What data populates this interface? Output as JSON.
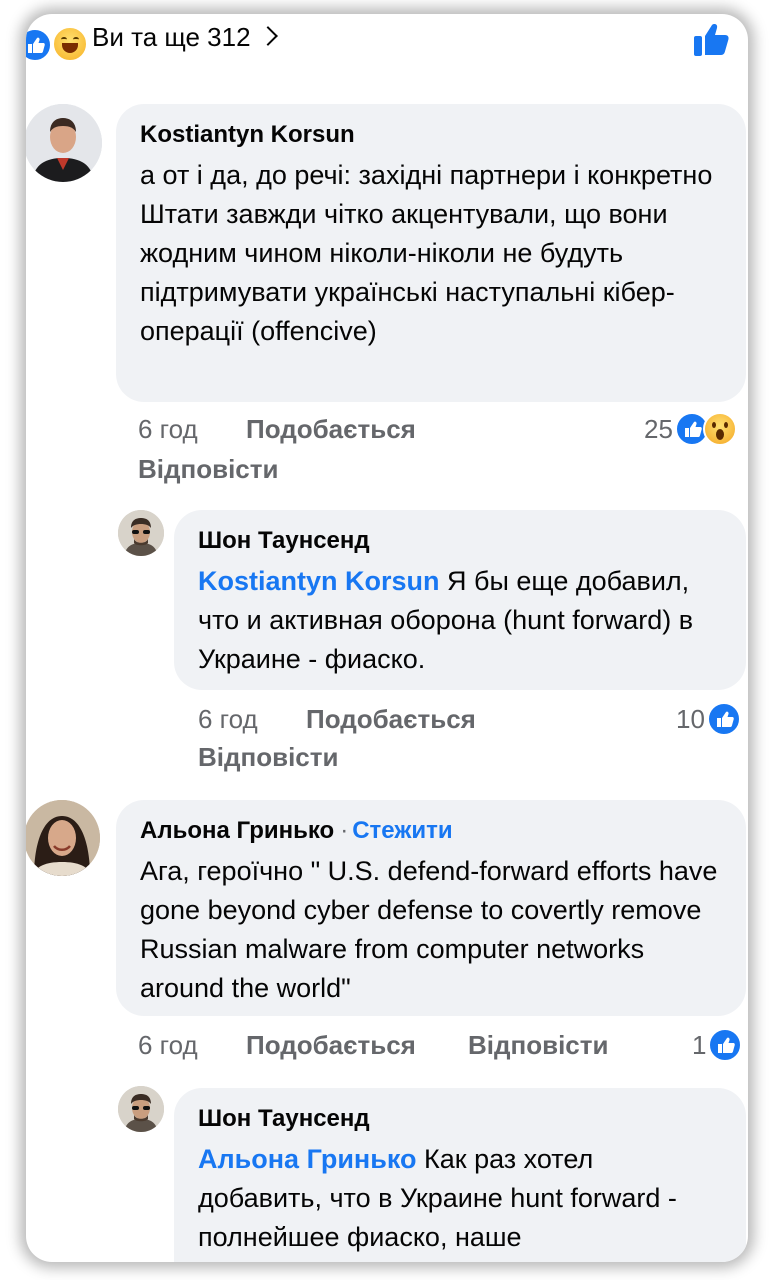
{
  "reactions_bar": {
    "summary": "Ви та ще 312"
  },
  "comments": [
    {
      "author": "Kostiantyn  Korsun",
      "text": "а от і да, до речі: західні партнери і конкретно Штати завжди чітко акцентували, що вони жодним чином ніколи-ніколи не будуть підтримувати українські наступальні кібер-операції (offencive)",
      "time": "6 год",
      "like_label": "Подобається",
      "reply_label": "Відповісти",
      "reaction_count": "25",
      "reaction_icons": [
        "like-icon",
        "wow-icon"
      ]
    },
    {
      "author": "Шон Таунсенд",
      "mention": "Kostiantyn  Korsun",
      "text": "Я бы еще добавил, что и активная оборона (hunt forward) в Украине - фиаско.",
      "time": "6 год",
      "like_label": "Подобається",
      "reply_label": "Відповісти",
      "reaction_count": "10",
      "reaction_icons": [
        "like-icon"
      ]
    },
    {
      "author": "Альона Гринько",
      "separator": "·",
      "follow_label": "Стежити",
      "text": "Ага, героїчно \" U.S. defend-forward efforts have gone beyond cyber defense to covertly remove Russian malware from computer networks around the world\"",
      "time": "6 год",
      "like_label": "Подобається",
      "reply_label": "Відповісти",
      "reaction_count": "1",
      "reaction_icons": [
        "like-icon"
      ]
    },
    {
      "author": "Шон Таунсенд",
      "mention": "Альона Гринько",
      "text": "Как раз хотел добавить, что в Украине hunt forward - полнейшее фиаско, наше"
    }
  ],
  "colors": {
    "accent": "#1877f2",
    "bubble": "#f0f2f5",
    "meta": "#65676b"
  }
}
